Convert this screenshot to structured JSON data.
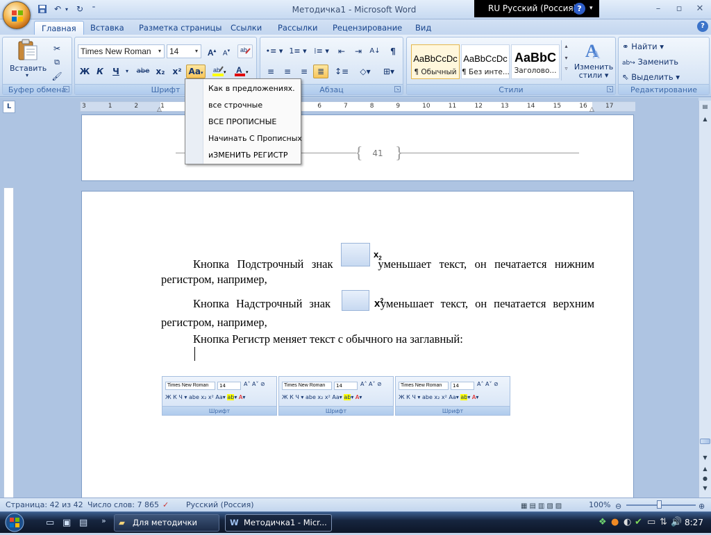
{
  "window": {
    "title": "Методичка1 - Microsoft Word",
    "language_bar": "RU Русский (Россия)"
  },
  "quick_access": {
    "save_icon": "save-icon",
    "undo_icon": "undo-icon",
    "redo_icon": "redo-icon"
  },
  "tabs": [
    "Главная",
    "Вставка",
    "Разметка страницы",
    "Ссылки",
    "Рассылки",
    "Рецензирование",
    "Вид"
  ],
  "ribbon": {
    "clipboard": {
      "paste_label": "Вставить",
      "group_label": "Буфер обмена"
    },
    "font": {
      "font_name": "Times New Roman",
      "font_size": "14",
      "bold": "Ж",
      "italic": "К",
      "underline": "Ч",
      "strike": "abe",
      "subscript": "x₂",
      "superscript": "x²",
      "case": "Аа",
      "font_color": "А",
      "grow": "A",
      "shrink": "A",
      "group_label": "Шрифт"
    },
    "paragraph": {
      "group_label": "Абзац"
    },
    "styles": {
      "tiles": [
        {
          "sample": "AaBbCcDc",
          "name": "¶ Обычный"
        },
        {
          "sample": "AaBbCcDc",
          "name": "¶ Без инте..."
        },
        {
          "sample": "AaBbC",
          "name": "Заголово..."
        }
      ],
      "change_styles": "Изменить",
      "change_styles2": "стили",
      "group_label": "Стили"
    },
    "editing": {
      "find": "Найти",
      "replace": "Заменить",
      "select": "Выделить",
      "group_label": "Редактирование"
    }
  },
  "case_menu": {
    "items": [
      "Как в предложениях.",
      "все строчные",
      "ВСЕ ПРОПИСНЫЕ",
      "Начинать С Прописных",
      "иЗМЕНИТЬ РЕГИСТР"
    ]
  },
  "document": {
    "page_number": "41",
    "para1_a": "Кнопка Подстрочный знак",
    "para1_b": "уменьшает текст, он печатается нижним регистром, например,",
    "para2_a": "Кнопка Надстрочный знак",
    "para2_b": "уменьшает текст, он печатается верхним регистром, например,",
    "para3": "Кнопка Регистр меняет текст с обычного на заглавный:",
    "mini_panels": [
      {
        "font": "Times New Roman",
        "size": "14",
        "label": "Шрифт"
      },
      {
        "font": "Times New Roman",
        "size": "14",
        "label": "Шрифт"
      },
      {
        "font": "Times New Roman",
        "size": "14",
        "label": "Шрифт"
      }
    ]
  },
  "ruler": {
    "ticks": [
      "3",
      "1",
      "2",
      "1",
      "1",
      "2",
      "3",
      "4",
      "5",
      "6",
      "7",
      "8",
      "9",
      "10",
      "11",
      "12",
      "13",
      "14",
      "15",
      "16",
      "17"
    ]
  },
  "statusbar": {
    "page": "Страница: 42 из 42",
    "words": "Число слов: 7 865",
    "language": "Русский (Россия)",
    "zoom": "100%"
  },
  "taskbar": {
    "items": [
      "Для методички",
      "Методичка1 - Micr..."
    ],
    "clock": "8:27"
  },
  "colors": {
    "accent": "#15428b",
    "highlight": "#f8c55a",
    "font_color_red": "#e00000",
    "highlight_yellow": "#ffff00"
  }
}
